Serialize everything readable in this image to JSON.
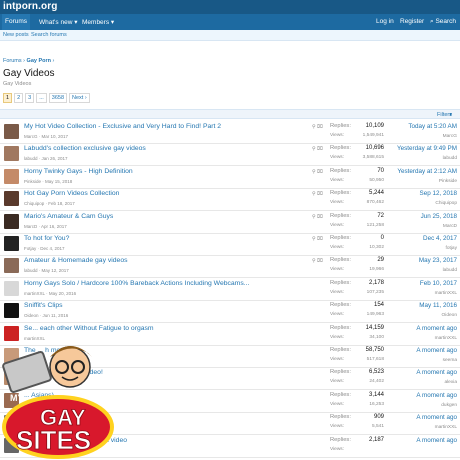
{
  "site": {
    "logo": "intporn.org"
  },
  "nav": {
    "tabs": [
      "Forums",
      "What's new",
      "Members"
    ],
    "right": [
      "Log in",
      "Register",
      "Search"
    ],
    "sub": [
      "New posts",
      "Search forums"
    ]
  },
  "breadcrumb": {
    "root": "Forums",
    "current": "Gay Porn"
  },
  "page": {
    "title": "Gay Videos",
    "description": "Gay Videos"
  },
  "pager": {
    "pages": [
      "1",
      "2",
      "3",
      "...",
      "3658"
    ],
    "next": "Next"
  },
  "filters": {
    "label": "Filters"
  },
  "labels": {
    "replies": "Replies:",
    "views": "Views:"
  },
  "threads": [
    {
      "title": "My Hot Video Collection - Exclusive and Very Hard to Find! Part 2",
      "meta": "MarcG · Mar 10, 2017",
      "replies": "10,109",
      "views": "1,549,941",
      "last_date": "Today at 5:20 AM",
      "last_user": "MarcG",
      "thumb": "#7a5a48",
      "sticky": true
    },
    {
      "title": "Labudd's collection exclusive gay videos",
      "meta": "labudd · Jan 26, 2017",
      "replies": "10,696",
      "views": "3,588,615",
      "last_date": "Yesterday at 9:49 PM",
      "last_user": "labudd",
      "thumb": "#a07860",
      "sticky": true
    },
    {
      "title": "Horny Twinky Gays - High Definition",
      "meta": "Pinkside · May 15, 2018",
      "replies": "70",
      "views": "50,950",
      "last_date": "Yesterday at 2:12 AM",
      "last_user": "Pinkside",
      "thumb": "#c48a68",
      "sticky": true
    },
    {
      "title": "Hot Gay Porn Videos Collection",
      "meta": "Chiquipop · Feb 18, 2017",
      "replies": "5,244",
      "views": "870,462",
      "last_date": "Sep 12, 2018",
      "last_user": "Chiquipop",
      "thumb": "#5a3a2c",
      "sticky": true
    },
    {
      "title": "Mario's Amateur & Cam Guys",
      "meta": "MarcD · Apr 16, 2017",
      "replies": "72",
      "views": "121,258",
      "last_date": "Jun 25, 2018",
      "last_user": "MarcD",
      "thumb": "#3a2a22",
      "sticky": true
    },
    {
      "title": "To hot for You?",
      "meta": "Fotjay · Dec 4, 2017",
      "replies": "0",
      "views": "10,302",
      "last_date": "Dec 4, 2017",
      "last_user": "fotjay",
      "thumb": "#222222",
      "sticky": true
    },
    {
      "title": "Amateur & Homemade gay videos",
      "meta": "labudd · May 12, 2017",
      "replies": "29",
      "views": "19,966",
      "last_date": "May 23, 2017",
      "last_user": "labudd",
      "thumb": "#8a6a58",
      "sticky": true
    },
    {
      "title": "Horny Gays Solo / Hardcore 100% Bareback Actions Including Webcams...",
      "meta": "martinXXL · May 20, 2016",
      "replies": "2,178",
      "views": "107,235",
      "last_date": "Feb 10, 2017",
      "last_user": "martinXXL",
      "thumb": "#d8d8d8",
      "sticky": false
    },
    {
      "title": "Sniffit's Clips",
      "meta": "Oideon · Jun 11, 2016",
      "replies": "154",
      "views": "149,963",
      "last_date": "May 11, 2016",
      "last_user": "Oideon",
      "thumb": "#111111",
      "sticky": false
    },
    {
      "title": "Se... each other Without Fatigue to orgasm",
      "meta": "martinXXL",
      "replies": "14,159",
      "views": "34,100",
      "last_date": "A moment ago",
      "last_user": "martinXXL",
      "thumb": "#cc2222",
      "sticky": false
    },
    {
      "title": "The ... h movies!",
      "meta": "seema",
      "replies": "58,750",
      "views": "517,618",
      "last_date": "A moment ago",
      "last_user": "seema",
      "thumb": "#c89a7a",
      "sticky": false
    },
    {
      "title": "... s - Only the Best Video!",
      "meta": "alexia",
      "replies": "6,523",
      "views": "24,402",
      "last_date": "A moment ago",
      "last_user": "alexia",
      "thumb": "#b88a6a",
      "sticky": false
    },
    {
      "title": "... Asians)",
      "meta": "dukgen",
      "replies": "3,144",
      "views": "16,253",
      "last_date": "A moment ago",
      "last_user": "dukgen",
      "thumb": "#9a6a50",
      "sticky": false
    },
    {
      "title": "...",
      "meta": "",
      "replies": "909",
      "views": "5,541",
      "last_date": "A moment ago",
      "last_user": "martinXXL",
      "thumb": "#777777",
      "sticky": false
    },
    {
      "title": "Gay Videos ... most unusual video",
      "meta": "",
      "replies": "2,187",
      "views": "",
      "last_date": "A moment ago",
      "last_user": "",
      "thumb": "#666666",
      "sticky": false
    }
  ],
  "badge": {
    "line1": "GAY",
    "line2": "SITES",
    "corner": "MY"
  },
  "colors": {
    "header": "#185886",
    "nav": "#1d6aa1",
    "link": "#2577b1",
    "badge_red": "#d8182c",
    "badge_yellow": "#ffd21f"
  }
}
